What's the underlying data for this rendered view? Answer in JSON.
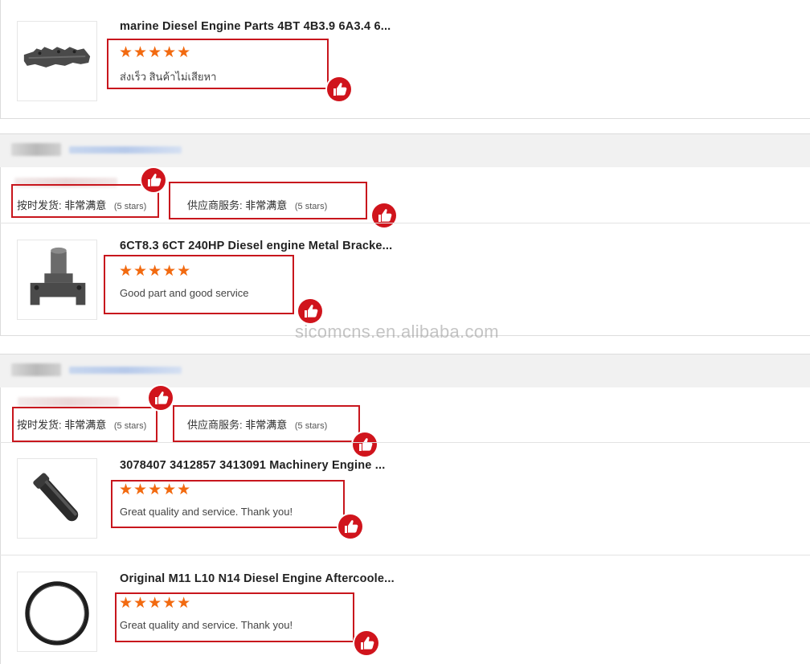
{
  "watermark": "sicomcns.en.alibaba.com",
  "reviews": [
    {
      "product_title": "marine Diesel Engine Parts 4BT 4B3.9 6A3.4 6...",
      "stars": "★★★★★",
      "comment": "ส่งเร็ว สินค้าไม่เสียหา"
    },
    {
      "delivery_label": "按时发货:",
      "delivery_value": "非常满意",
      "delivery_stars": "(5 stars)",
      "service_label": "供应商服务:",
      "service_value": "非常满意",
      "service_stars": "(5 stars)",
      "product_title": "6CT8.3 6CT 240HP Diesel engine Metal Bracke...",
      "stars": "★★★★★",
      "comment": "Good part and good service"
    },
    {
      "delivery_label": "按时发货:",
      "delivery_value": "非常满意",
      "delivery_stars": "(5 stars)",
      "service_label": "供应商服务:",
      "service_value": "非常满意",
      "service_stars": "(5 stars)",
      "items": [
        {
          "product_title": "3078407 3412857 3413091 Machinery Engine ...",
          "stars": "★★★★★",
          "comment": "Great quality and service. Thank you!"
        },
        {
          "product_title": "Original M11 L10 N14 Diesel Engine Aftercoole...",
          "stars": "★★★★★",
          "comment": "Great quality and service. Thank you!"
        }
      ]
    }
  ],
  "colors": {
    "highlight": "#c8161d",
    "star": "#f26a10",
    "badge": "#d0141c"
  },
  "icons": [
    "thumbs-up-icon"
  ]
}
